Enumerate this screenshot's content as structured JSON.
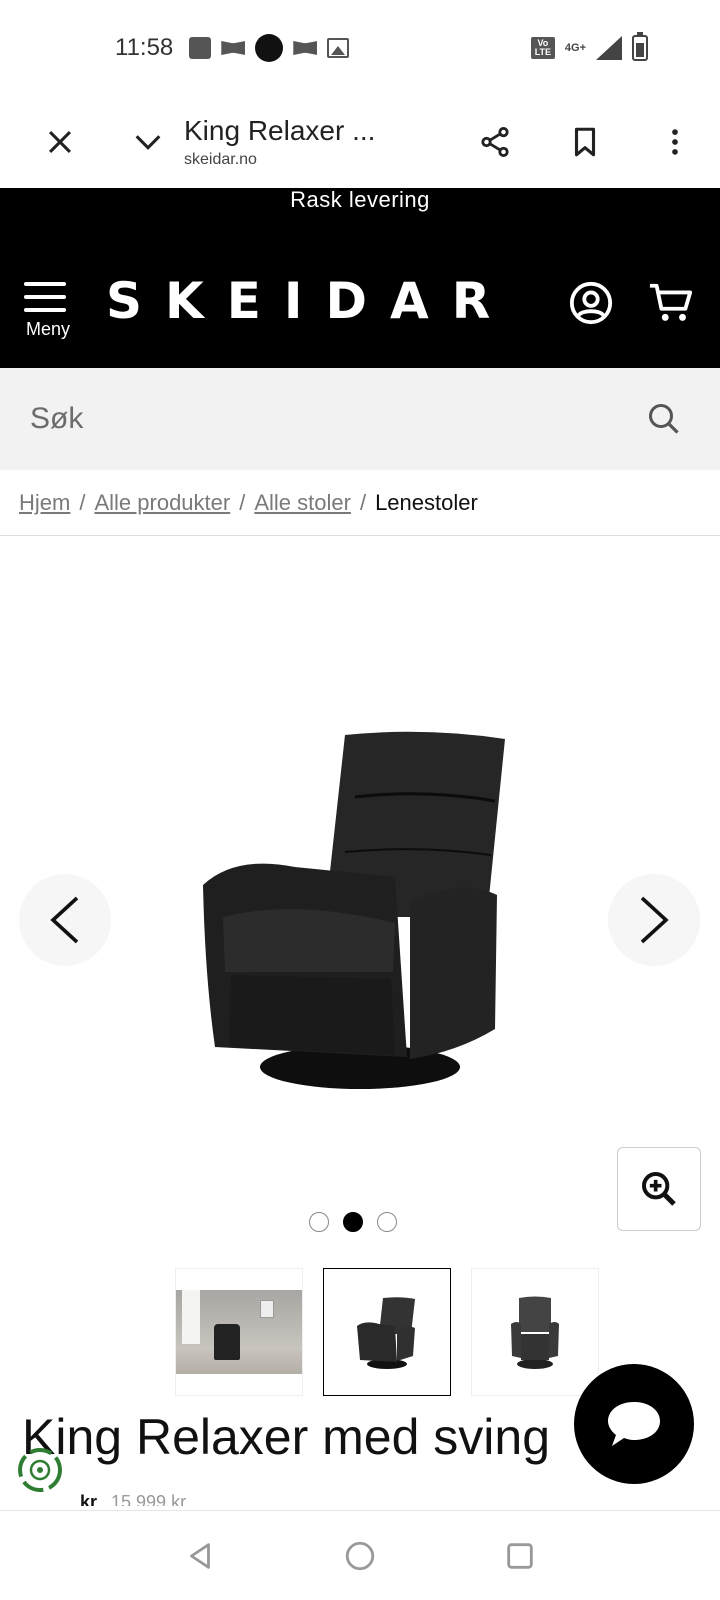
{
  "status_bar": {
    "time": "11:58",
    "network": "4G+",
    "volte": "Vo LTE"
  },
  "browser": {
    "page_title": "King Relaxer ...",
    "url": "skeidar.no"
  },
  "site": {
    "promo": "Rask levering",
    "logo": "SKEIDAR",
    "menu_label": "Meny",
    "search_placeholder": "Søk"
  },
  "breadcrumb": {
    "items": [
      "Hjem",
      "Alle produkter",
      "Alle stoler"
    ],
    "current": "Lenestoler"
  },
  "gallery": {
    "dot_count": 3,
    "active_dot": 1,
    "selected_thumb": 1
  },
  "product": {
    "title_visible": "King Relaxer med sving",
    "price_strip": "15 999 kr",
    "price_prefix": "kr"
  },
  "colors": {
    "header_bg": "#000000",
    "search_bg": "#f2f2f2",
    "eco_green": "#2e7d32"
  }
}
